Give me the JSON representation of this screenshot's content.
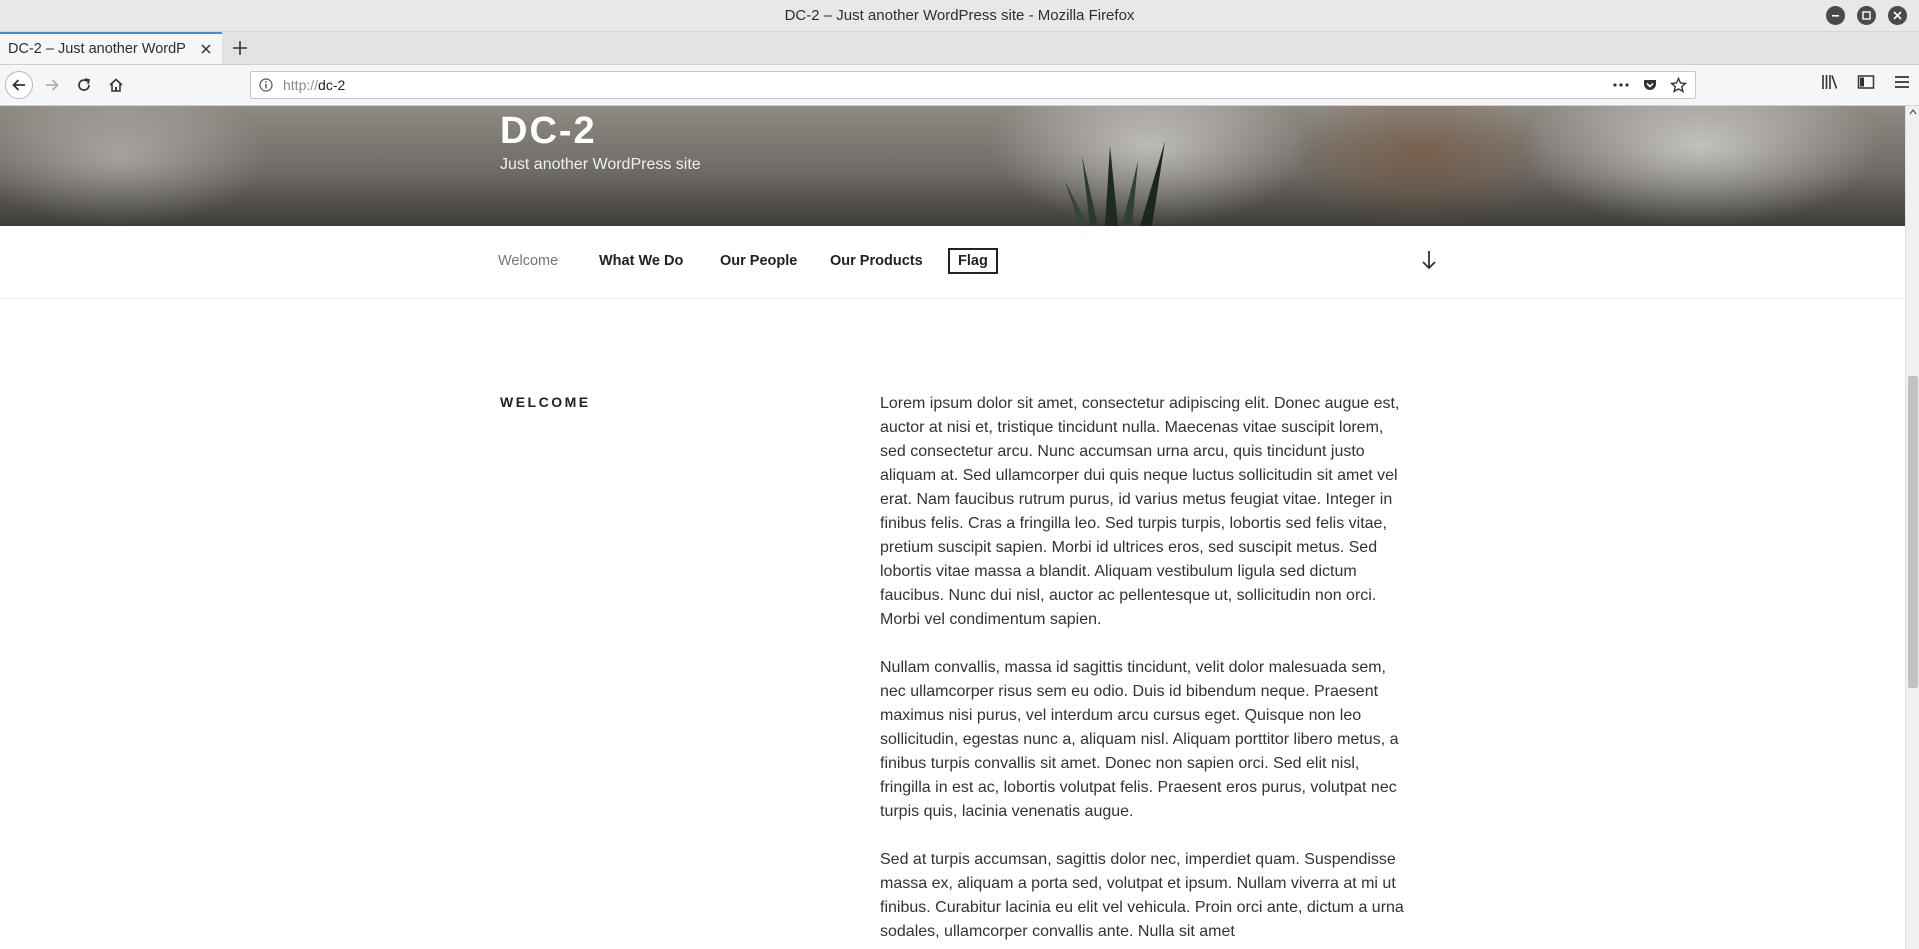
{
  "window": {
    "title": "DC-2 – Just another WordPress site - Mozilla Firefox"
  },
  "tab": {
    "title": "DC-2 – Just another WordP"
  },
  "url": {
    "protocol": "http://",
    "host": "dc-2"
  },
  "site": {
    "title": "DC-2",
    "description": "Just another WordPress site"
  },
  "menu": {
    "items": [
      "Welcome",
      "What We Do",
      "Our People",
      "Our Products",
      "Flag"
    ]
  },
  "entry": {
    "title": "WELCOME",
    "paragraphs": [
      "Lorem ipsum dolor sit amet, consectetur adipiscing elit. Donec augue est, auctor at nisi et, tristique tincidunt nulla. Maecenas vitae suscipit lorem, sed consectetur arcu. Nunc accumsan urna arcu, quis tincidunt justo aliquam at. Sed ullamcorper dui quis neque luctus sollicitudin sit amet vel erat. Nam faucibus rutrum purus, id varius metus feugiat vitae. Integer in finibus felis. Cras a fringilla leo. Sed turpis turpis, lobortis sed felis vitae, pretium suscipit sapien. Morbi id ultrices eros, sed suscipit metus. Sed lobortis vitae massa a blandit. Aliquam vestibulum ligula sed dictum faucibus. Nunc dui nisl, auctor ac pellentesque ut, sollicitudin non orci. Morbi vel condimentum sapien.",
      "Nullam convallis, massa id sagittis tincidunt, velit dolor malesuada sem, nec ullamcorper risus sem eu odio. Duis id bibendum neque. Praesent maximus nisi purus, vel interdum arcu cursus eget. Quisque non leo sollicitudin, egestas nunc a, aliquam nisl. Aliquam porttitor libero metus, a finibus turpis convallis sit amet. Donec non sapien orci. Sed elit nisl, fringilla in est ac, lobortis volutpat felis. Praesent eros purus, volutpat nec turpis quis, lacinia venenatis augue.",
      "Sed at turpis accumsan, sagittis dolor nec, imperdiet quam. Suspendisse massa ex, aliquam a porta sed, volutpat et ipsum. Nullam viverra at mi ut finibus. Curabitur lacinia eu elit vel vehicula. Proin orci ante, dictum a urna sodales, ullamcorper convallis ante. Nulla sit amet"
    ]
  },
  "icons": {
    "back": "back-arrow-icon",
    "forward": "forward-arrow-icon",
    "reload": "reload-icon",
    "home": "home-icon",
    "info": "info-icon",
    "more": "page-actions-icon",
    "pocket": "pocket-icon",
    "bookmark": "star-icon",
    "library": "library-icon",
    "sidebar": "sidebar-icon",
    "menu": "hamburger-menu-icon"
  },
  "colors": {
    "tab_accent": "#3b8ee0",
    "menu_current": "#767676"
  }
}
